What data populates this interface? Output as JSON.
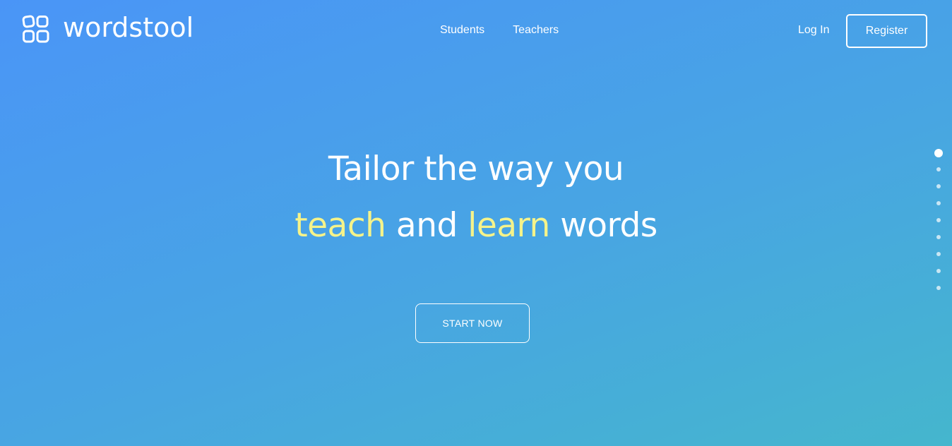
{
  "brand": {
    "name": "wordstool",
    "icon": "four-rounded-squares-logo-icon"
  },
  "nav": {
    "links": [
      {
        "label": "Students"
      },
      {
        "label": "Teachers"
      }
    ],
    "login_label": "Log In",
    "register_label": "Register"
  },
  "hero": {
    "line1": "Tailor the way you",
    "line2": {
      "word1": "teach",
      "word2": " and ",
      "word3": "learn",
      "word4": " words"
    },
    "cta_label": "START NOW"
  },
  "pager": {
    "count": 9,
    "active_index": 0
  },
  "colors": {
    "gradient_start": "#4a95f7",
    "gradient_end": "#45b6cd",
    "highlight": "#f5f38a",
    "text": "#ffffff"
  }
}
